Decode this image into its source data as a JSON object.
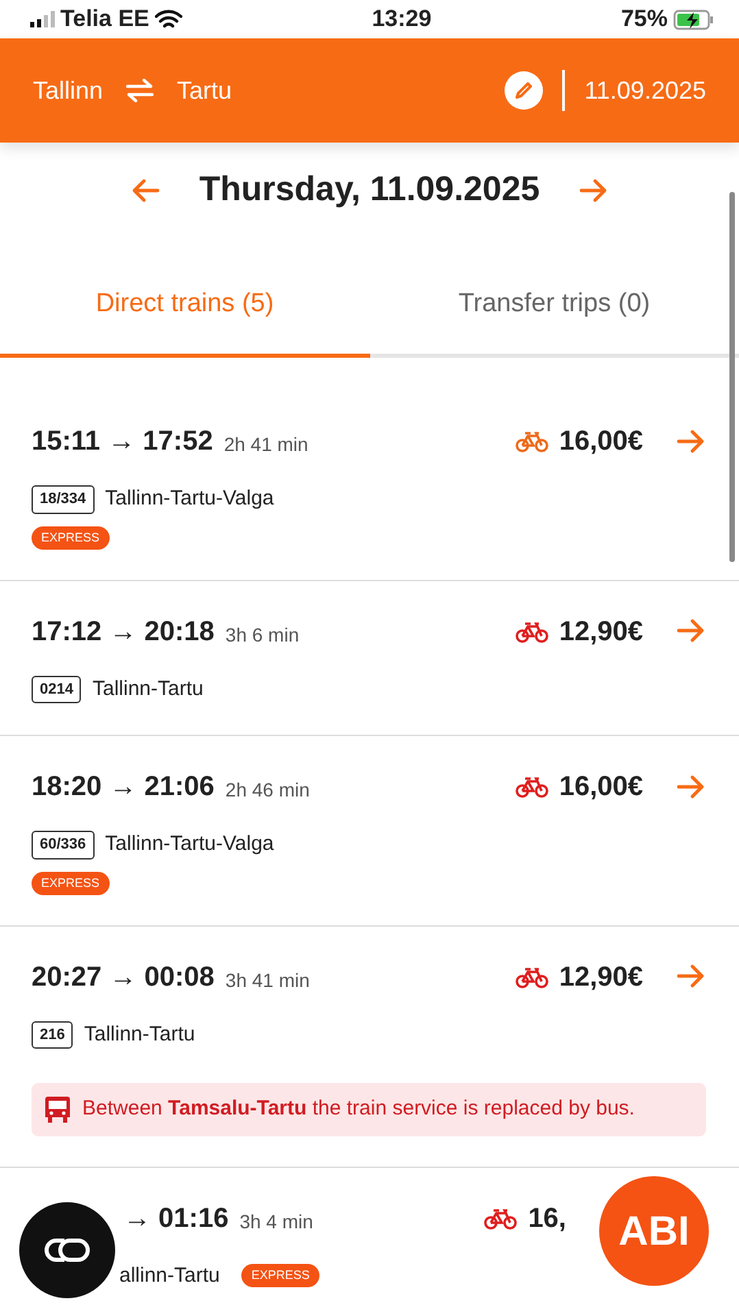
{
  "status_bar": {
    "carrier": "Telia EE",
    "time": "13:29",
    "battery": "75%"
  },
  "header": {
    "from": "Tallinn",
    "to": "Tartu",
    "date": "11.09.2025"
  },
  "day": {
    "title": "Thursday, 11.09.2025"
  },
  "tabs": [
    {
      "label": "Direct trains (5)",
      "selected": true
    },
    {
      "label": "Transfer trips (0)",
      "selected": false
    }
  ],
  "trips": [
    {
      "depart": "15:11",
      "arrow": "→",
      "arrive": "17:52",
      "duration": "2h 41 min",
      "price": "16,00€",
      "color": "#ee6a1a",
      "train_number": "18/334",
      "route": "Tallinn-Tartu-Valga",
      "express": "EXPRESS"
    },
    {
      "depart": "17:12",
      "arrow": "→",
      "arrive": "20:18",
      "duration": "3h 6 min",
      "price": "12,90€",
      "color": "#e01e1e",
      "train_number": "0214",
      "route": "Tallinn-Tartu"
    },
    {
      "depart": "18:20",
      "arrow": "→",
      "arrive": "21:06",
      "duration": "2h 46 min",
      "price": "16,00€",
      "color": "#e01e1e",
      "train_number": "60/336",
      "route": "Tallinn-Tartu-Valga",
      "express": "EXPRESS"
    },
    {
      "depart": "20:27",
      "arrow": "→",
      "arrive": "00:08",
      "duration": "3h 41 min",
      "price": "12,90€",
      "color": "#e01e1e",
      "train_number": "216",
      "route": "Tallinn-Tartu",
      "notice": "Between **Tamsalu-Tartu** the train service is replaced by bus."
    },
    {
      "kind": "covered",
      "arrow": "→",
      "arrive": "01:16",
      "duration": "3h 4 min",
      "price": "16,",
      "color": "#e01e1e",
      "route": "allinn-Tartu",
      "express": "EXPRESS"
    }
  ],
  "help_button": "ABI"
}
